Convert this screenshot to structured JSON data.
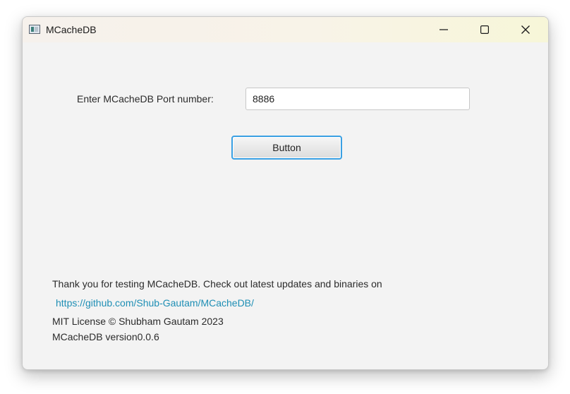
{
  "window": {
    "title": "MCacheDB",
    "icons": {
      "app": "app-window-icon",
      "minimize": "minimize-icon",
      "maximize": "maximize-icon",
      "close": "close-icon"
    }
  },
  "form": {
    "port_label": "Enter MCacheDB Port number:",
    "port_value": "8886",
    "button_label": "Button",
    "accent_color": "#3aa0e3"
  },
  "footer": {
    "thanks": "Thank you for testing MCacheDB. Check out latest updates and binaries on",
    "link": "https://github.com/Shub-Gautam/MCacheDB/",
    "license": "MIT License © Shubham Gautam  2023",
    "version": "MCacheDB version0.0.6",
    "link_color": "#1f8fb5"
  }
}
